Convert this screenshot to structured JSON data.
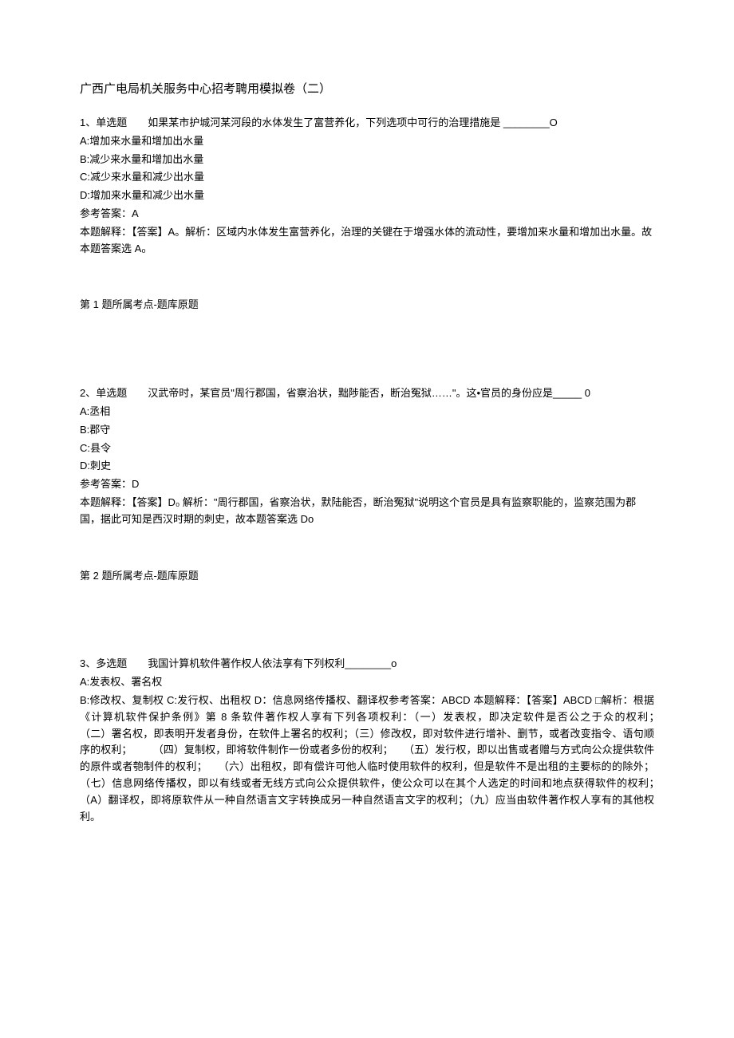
{
  "title": "广西广电局机关服务中心招考聘用模拟卷（二）",
  "q1": {
    "stem": "1、单选题　　如果某市护城河某河段的水体发生了富营养化，下列选项中可行的治理措施是 ________O",
    "optA": "A:增加来水量和增加出水量",
    "optB": "B:减少来水量和增加出水量",
    "optC": "C:减少来水量和减少出水量",
    "optD": "D:增加来水量和减少出水量",
    "answer": "参考答案：A",
    "explain": "本题解释：【答案】A。解析：区域内水体发生富营养化，治理的关键在于增强水体的流动性，要增加来水量和增加出水量。故本题答案选 A₀",
    "source": "第 1 题所属考点-题库原题"
  },
  "q2": {
    "stem": "2、单选题　　汉武帝时，某官员\"周行郡国，省察治状，黜陟能否，断治冤狱……\"。这•官员的身份应是_____ 0",
    "optA": "A:丞相",
    "optB": "B:郡守",
    "optC": "C:县令",
    "optD": "D:刺史",
    "answer": "参考答案：D",
    "explain": "本题解释：【答案】D₀ 解析：\"周行郡国，省察治状，默陆能否，断治冤狱\"说明这个官员是具有监察职能的，监察范围为郡国，据此可知是西汉时期的刺史，故本题答案选 Do",
    "source": "第 2 题所属考点-题库原题"
  },
  "q3": {
    "stem": "3、多选题　　我国计算机软件著作权人依法享有下列权利________o",
    "optA": "A:发表权、署名权",
    "body": "B:修改权、复制权 C:发行权、出租权 D：信息网络传播权、翻译权参考答案：ABCD 本题解释：【答案】ABCD □解析：根据《计算机软件保护条例》第 8 条软件著作权人享有下列各项权利：（一）发表权，即决定软件是否公之于众的权利；　　　　　　　　　　　　（二）署名权，即表明开发者身份，在软件上署名的权利；（三）修改权，即对软件进行增补、删节，或者改变指令、语句顺序的权利；　　　（四）复制权，即将软件制作一份或者多份的权利；　　（五）发行权，即以出售或者赠与方式向公众提供软件的原件或者匏制件的权利；　　（六）出租权，即有偿许可他人临时使用软件的权利，但是软件不是出租的主要标的的除外；（七）信息网络传播权，即以有线或者无线方式向公众提供软件，使公众可以在其个人选定的时间和地点获得软件的权利；　　　　　（A）翻译权，即将原软件从一种自然语言文字转换成另一种自然语言文字的权利；（九）应当由软件著作权人享有的其他权利。"
  }
}
